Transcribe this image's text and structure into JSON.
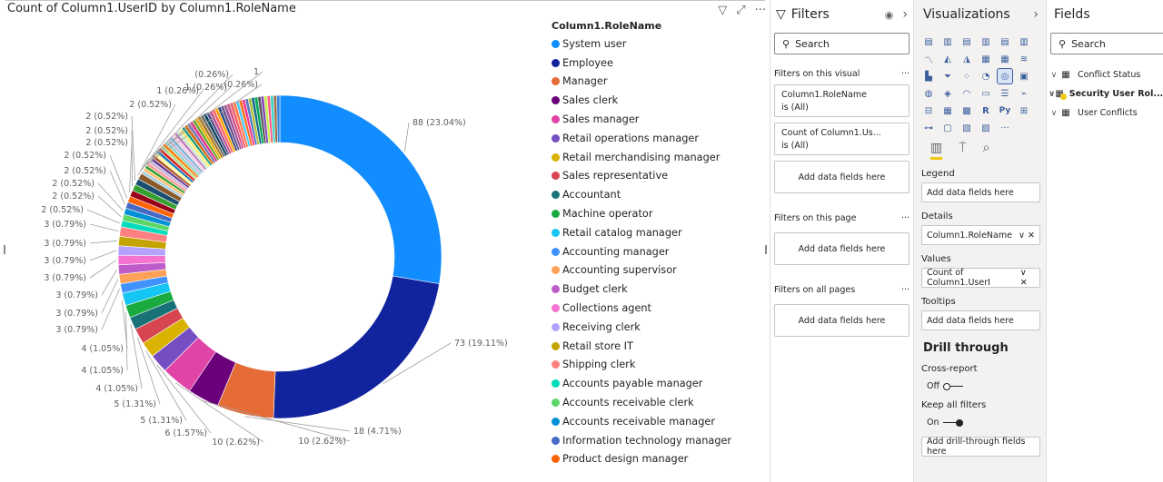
{
  "visual": {
    "title": "Count of Column1.UserID by Column1.RoleName",
    "icons": [
      "filter-icon",
      "focus-mode-icon",
      "more-options-icon"
    ]
  },
  "chart_data": {
    "type": "pie",
    "donut": true,
    "title": "Count of Column1.UserID by Column1.RoleName",
    "legend_title": "Column1.RoleName",
    "legend_position": "right",
    "total": 382,
    "slices": [
      {
        "name": "System user",
        "value": 88,
        "label": "88 (23.04%)",
        "color": "#118dff"
      },
      {
        "name": "Employee",
        "value": 73,
        "label": "73 (19.11%)",
        "color": "#12239e"
      },
      {
        "name": "Manager",
        "value": 18,
        "label": "18 (4.71%)",
        "color": "#e66c37"
      },
      {
        "name": "Sales clerk",
        "value": 10,
        "label": "10 (2.62%)",
        "color": "#6b007b"
      },
      {
        "name": "Sales manager",
        "value": 10,
        "label": "10 (2.62%)",
        "color": "#e044a7"
      },
      {
        "name": "Retail operations manager",
        "value": 6,
        "label": "6 (1.57%)",
        "color": "#744ec2"
      },
      {
        "name": "Retail merchandising manager",
        "value": 5,
        "label": "5 (1.31%)",
        "color": "#d9b300"
      },
      {
        "name": "Sales representative",
        "value": 5,
        "label": "5 (1.31%)",
        "color": "#d64550"
      },
      {
        "name": "Accountant",
        "value": 4,
        "label": "4 (1.05%)",
        "color": "#197278"
      },
      {
        "name": "Machine operator",
        "value": 4,
        "label": "4 (1.05%)",
        "color": "#1aab40"
      },
      {
        "name": "Retail catalog manager",
        "value": 4,
        "label": "4 (1.05%)",
        "color": "#15c6f4"
      },
      {
        "name": "Accounting manager",
        "value": 3,
        "label": "3 (0.79%)",
        "color": "#4092ff"
      },
      {
        "name": "Accounting supervisor",
        "value": 3,
        "label": "3 (0.79%)",
        "color": "#ffa058"
      },
      {
        "name": "Budget clerk",
        "value": 3,
        "label": "3 (0.79%)",
        "color": "#be5dc9"
      },
      {
        "name": "Collections agent",
        "value": 3,
        "label": "3 (0.79%)",
        "color": "#f472d0"
      },
      {
        "name": "Receiving clerk",
        "value": 3,
        "label": "3 (0.79%)",
        "color": "#b5a1ff"
      },
      {
        "name": "Retail store IT",
        "value": 3,
        "label": "3 (0.79%)",
        "color": "#c4a200"
      },
      {
        "name": "Shipping clerk",
        "value": 3,
        "label": "3 (0.79%)",
        "color": "#ff8080"
      },
      {
        "name": "Accounts payable manager",
        "value": 2,
        "label": "2 (0.52%)",
        "color": "#00dbbc"
      },
      {
        "name": "Accounts receivable clerk",
        "value": 2,
        "label": "2 (0.52%)",
        "color": "#5bd667"
      },
      {
        "name": "Accounts receivable manager",
        "value": 2,
        "label": "2 (0.52%)",
        "color": "#0091d5"
      },
      {
        "name": "Information technology manager",
        "value": 2,
        "label": "2 (0.52%)",
        "color": "#4668c5"
      },
      {
        "name": "Product design manager",
        "value": 2,
        "label": "2 (0.52%)",
        "color": "#ff6300"
      },
      {
        "name": "",
        "value": 2,
        "label": "2 (0.52%)",
        "color": "#99001a"
      },
      {
        "name": "",
        "value": 2,
        "label": "2 (0.52%)",
        "color": "#35a02e"
      },
      {
        "name": "",
        "value": 2,
        "label": "2 (0.52%)",
        "color": "#1b4f72"
      },
      {
        "name": "",
        "value": 2,
        "label": "2 (0.52%)",
        "color": "#8a5a2b"
      },
      {
        "name": "",
        "value": 1,
        "label": "1 (0.26%)",
        "color": "#a6cee3"
      },
      {
        "name": "",
        "value": 1,
        "label": "1 (0.26%)",
        "color": "#fdbf6f"
      },
      {
        "name": "",
        "value": 1,
        "label": "1 (0.26%)",
        "color": "#33a02c"
      },
      {
        "name": "",
        "value": 1,
        "label": "1 (0.26%)",
        "color": "#fb9a99"
      },
      {
        "name": "",
        "value": 1,
        "label": "1",
        "color": "#cab2d6"
      },
      {
        "name": "",
        "value": 1,
        "label": "",
        "color": "#6a3d9a"
      },
      {
        "name": "",
        "value": 1,
        "label": "",
        "color": "#b15928"
      },
      {
        "name": "",
        "value": 1,
        "label": "",
        "color": "#ffff99"
      },
      {
        "name": "",
        "value": 1,
        "label": "",
        "color": "#1f78b4"
      },
      {
        "name": "",
        "value": 1,
        "label": "",
        "color": "#e31a1c"
      },
      {
        "name": "",
        "value": 1,
        "label": "",
        "color": "#b2df8a"
      },
      {
        "name": "",
        "value": 1,
        "label": "",
        "color": "#ff7f00"
      },
      {
        "name": "",
        "value": 1,
        "label": "",
        "color": "#8dd3c7"
      },
      {
        "name": "",
        "value": 1,
        "label": "",
        "color": "#bebada"
      },
      {
        "name": "",
        "value": 1,
        "label": "",
        "color": "#80b1d3"
      },
      {
        "name": "",
        "value": 1,
        "label": "",
        "color": "#fccde5"
      },
      {
        "name": "",
        "value": 1,
        "label": "",
        "color": "#bc80bd"
      },
      {
        "name": "",
        "value": 1,
        "label": "",
        "color": "#ccebc5"
      },
      {
        "name": "",
        "value": 1,
        "label": "",
        "color": "#ffed6f"
      },
      {
        "name": "",
        "value": 1,
        "label": "",
        "color": "#1b9e77"
      },
      {
        "name": "",
        "value": 1,
        "label": "",
        "color": "#d95f02"
      },
      {
        "name": "",
        "value": 1,
        "label": "",
        "color": "#7570b3"
      },
      {
        "name": "",
        "value": 1,
        "label": "",
        "color": "#e7298a"
      },
      {
        "name": "",
        "value": 1,
        "label": "",
        "color": "#66a61e"
      },
      {
        "name": "",
        "value": 1,
        "label": "",
        "color": "#e6ab02"
      },
      {
        "name": "",
        "value": 1,
        "label": "",
        "color": "#a6761d"
      },
      {
        "name": "",
        "value": 1,
        "label": "",
        "color": "#666666"
      },
      {
        "name": "",
        "value": 1,
        "label": "",
        "color": "#003f5c"
      },
      {
        "name": "",
        "value": 1,
        "label": "",
        "color": "#58508d"
      },
      {
        "name": "",
        "value": 1,
        "label": "",
        "color": "#bc5090"
      },
      {
        "name": "",
        "value": 1,
        "label": "",
        "color": "#ff6361"
      },
      {
        "name": "",
        "value": 1,
        "label": "",
        "color": "#ffa600"
      },
      {
        "name": "",
        "value": 1,
        "label": "",
        "color": "#2f4b7c"
      },
      {
        "name": "",
        "value": 1,
        "label": "",
        "color": "#665191"
      },
      {
        "name": "",
        "value": 1,
        "label": "",
        "color": "#a05195"
      },
      {
        "name": "",
        "value": 1,
        "label": "",
        "color": "#d45087"
      },
      {
        "name": "",
        "value": 1,
        "label": "",
        "color": "#f95d6a"
      },
      {
        "name": "",
        "value": 1,
        "label": "",
        "color": "#ff7c43"
      },
      {
        "name": "",
        "value": 1,
        "label": "",
        "color": "#4dc9f6"
      },
      {
        "name": "",
        "value": 1,
        "label": "",
        "color": "#f67019"
      },
      {
        "name": "",
        "value": 1,
        "label": "",
        "color": "#f53794"
      },
      {
        "name": "",
        "value": 1,
        "label": "",
        "color": "#537bc4"
      },
      {
        "name": "",
        "value": 1,
        "label": "",
        "color": "#acc236"
      },
      {
        "name": "",
        "value": 1,
        "label": "",
        "color": "#166a8f"
      },
      {
        "name": "",
        "value": 1,
        "label": "",
        "color": "#00a950"
      },
      {
        "name": "",
        "value": 1,
        "label": "",
        "color": "#58595b"
      },
      {
        "name": "",
        "value": 1,
        "label": "",
        "color": "#8549ba"
      },
      {
        "name": "",
        "value": 1,
        "label": "",
        "color": "#c9f24a"
      },
      {
        "name": "",
        "value": 1,
        "label": "",
        "color": "#ff5e8a"
      },
      {
        "name": "",
        "value": 1,
        "label": "",
        "color": "#3dd6c6"
      },
      {
        "name": "",
        "value": 1,
        "label": "",
        "color": "#9b6b43"
      },
      {
        "name": "",
        "value": 1,
        "label": "",
        "color": "#2e86de"
      }
    ],
    "label_order": [
      "88 (23.04%)",
      "73 (19.11%)",
      "18 (4.71%)",
      "10 (2.62%)",
      "10 (2.62%)",
      "6 (1.57%)",
      "5 (1.31%)",
      "5 (1.31%)",
      "4 (1.05%)",
      "4 (1.05%)",
      "4 (1.05%)",
      "3 (0.79%)",
      "3 (0.79%)",
      "3 (0.79%)",
      "3 (0.79%)",
      "3 (0.79%)",
      "3 (0.79%)",
      "3 (0.79%)",
      "2 (0.52%)",
      "2 (0.52%)",
      "2 (0.52%)",
      "2 (0.52%)",
      "2 (0.52%)",
      "2 (0.52%)",
      "2 (0.52%)",
      "2 (0.52%)",
      "2 (0.52%)",
      "1 (0.26%)",
      "1 (0.26%)",
      "(0.26%)",
      "(0.26%)",
      "1",
      "1"
    ]
  },
  "filters": {
    "title": "Filters",
    "search_placeholder": "Search",
    "visual_section": "Filters on this visual",
    "cards": [
      {
        "field": "Column1.RoleName",
        "state": "is (All)"
      },
      {
        "field": "Count of Column1.Us...",
        "state": "is (All)"
      }
    ],
    "add_visual": "Add data fields here",
    "page_section": "Filters on this page",
    "add_page": "Add data fields here",
    "all_section": "Filters on all pages",
    "add_all": "Add data fields here"
  },
  "viz": {
    "title": "Visualizations",
    "legend_label": "Legend",
    "legend_placeholder": "Add data fields here",
    "details_label": "Details",
    "details_value": "Column1.RoleName",
    "values_label": "Values",
    "values_value": "Count of Column1.UserI",
    "tooltips_label": "Tooltips",
    "tooltips_placeholder": "Add data fields here",
    "drill_title": "Drill through",
    "cross_report": "Cross-report",
    "cross_state": "Off",
    "keep_filters": "Keep all filters",
    "keep_state": "On",
    "drill_placeholder": "Add drill-through fields here"
  },
  "fields": {
    "title": "Fields",
    "search_placeholder": "Search",
    "tables": [
      {
        "name": "Conflict Status",
        "bold": false
      },
      {
        "name": "Security User Rol...",
        "bold": true
      },
      {
        "name": "User Conflicts",
        "bold": false
      }
    ]
  }
}
